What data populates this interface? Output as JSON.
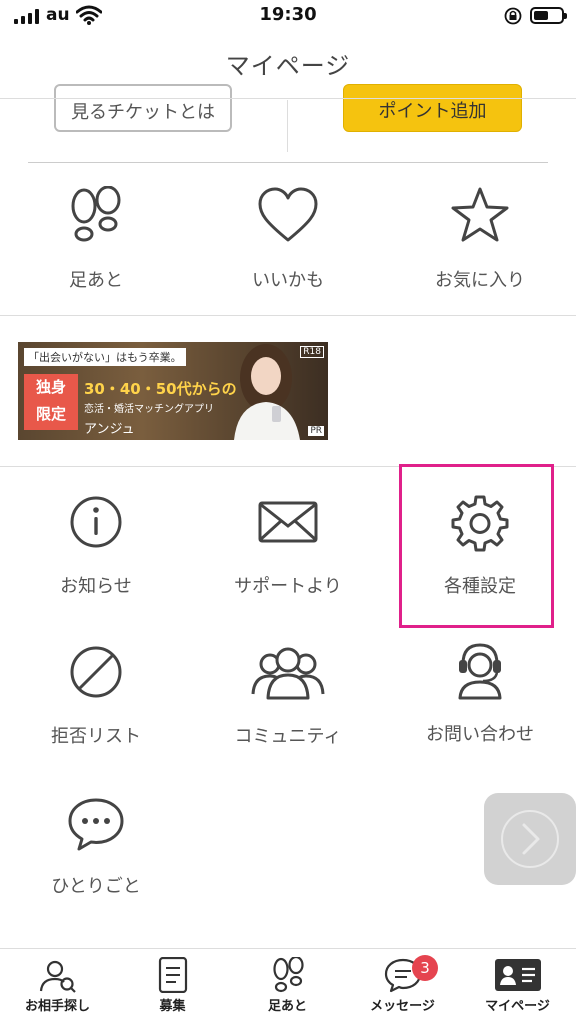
{
  "status_bar": {
    "carrier": "au",
    "time": "19:30"
  },
  "header": {
    "title": "マイページ"
  },
  "top_buttons": {
    "tickets_label": "見るチケットとは",
    "points_label": "ポイント追加"
  },
  "quick_links": [
    {
      "label": "足あと",
      "icon": "footprints-icon"
    },
    {
      "label": "いいかも",
      "icon": "heart-icon"
    },
    {
      "label": "お気に入り",
      "icon": "star-icon"
    }
  ],
  "banner": {
    "catch": "「出会いがない」はもう卒業。",
    "badge": [
      "独身",
      "限定"
    ],
    "ages": "30・40・50代からの",
    "subtitle": "恋活・婚活マッチングアプリ",
    "brand": "アンジュ",
    "r18": "R18",
    "pr": "PR"
  },
  "menu": [
    {
      "label": "お知らせ",
      "icon": "info-icon"
    },
    {
      "label": "サポートより",
      "icon": "envelope-icon"
    },
    {
      "label": "各種設定",
      "icon": "gear-icon"
    },
    {
      "label": "拒否リスト",
      "icon": "block-icon"
    },
    {
      "label": "コミュニティ",
      "icon": "community-icon"
    },
    {
      "label": "お問い合わせ",
      "icon": "headset-icon"
    },
    {
      "label": "ひとりごと",
      "icon": "speech-bubble-icon"
    }
  ],
  "tabbar": [
    {
      "label": "お相手探し",
      "icon": "search-person-icon"
    },
    {
      "label": "募集",
      "icon": "document-icon"
    },
    {
      "label": "足あと",
      "icon": "footprints-icon"
    },
    {
      "label": "メッセージ",
      "icon": "message-icon",
      "badge": "3"
    },
    {
      "label": "マイページ",
      "icon": "profile-card-icon"
    }
  ],
  "colors": {
    "accent_yellow": "#f5c30f",
    "highlight_pink": "#e0208a",
    "badge_red": "#e5444f"
  }
}
